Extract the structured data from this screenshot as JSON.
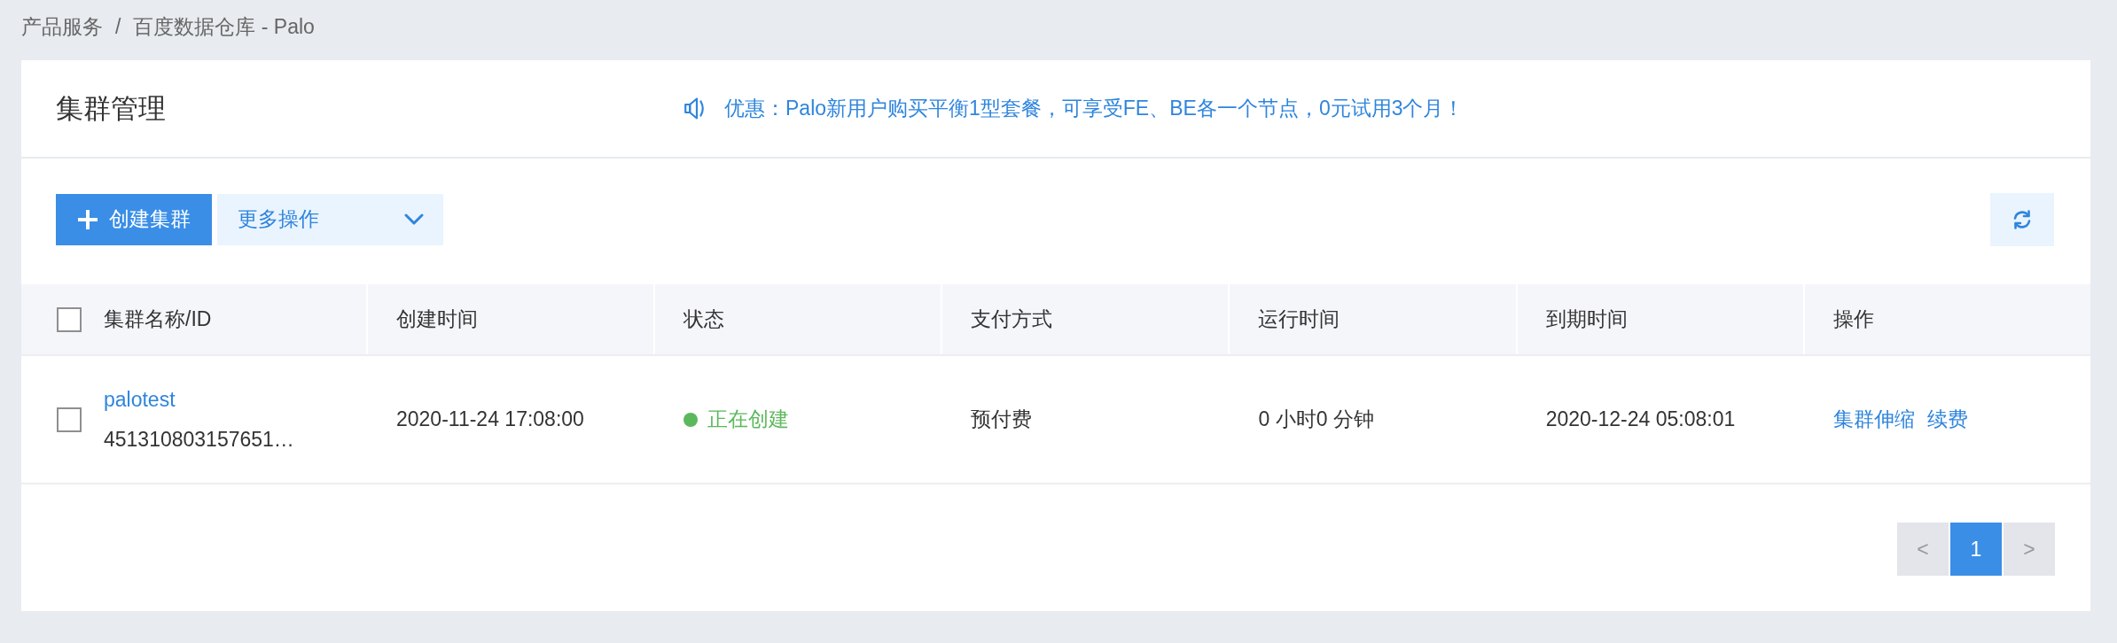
{
  "breadcrumb": {
    "items": [
      "产品服务",
      "百度数据仓库 - Palo"
    ],
    "separator": "/"
  },
  "header": {
    "title": "集群管理",
    "notice": "优惠：Palo新用户购买平衡1型套餐，可享受FE、BE各一个节点，0元试用3个月！"
  },
  "toolbar": {
    "create_button": "创建集群",
    "more_actions": "更多操作"
  },
  "table": {
    "all_selected": false,
    "columns": [
      "集群名称/ID",
      "创建时间",
      "状态",
      "支付方式",
      "运行时间",
      "到期时间",
      "操作"
    ],
    "rows": [
      {
        "selected": false,
        "name": "palotest",
        "id": "451310803157651…",
        "created": "2020-11-24 17:08:00",
        "status": {
          "label": "正在创建",
          "color": "#5cb85c"
        },
        "payment": "预付费",
        "runtime": "0 小时0 分钟",
        "expires": "2020-12-24 05:08:01",
        "actions": [
          "集群伸缩",
          "续费"
        ]
      }
    ]
  },
  "pagination": {
    "prev": {
      "label": "<",
      "disabled": true
    },
    "pages": [
      {
        "label": "1",
        "selected": true
      }
    ],
    "next": {
      "label": ">",
      "disabled": true
    }
  }
}
